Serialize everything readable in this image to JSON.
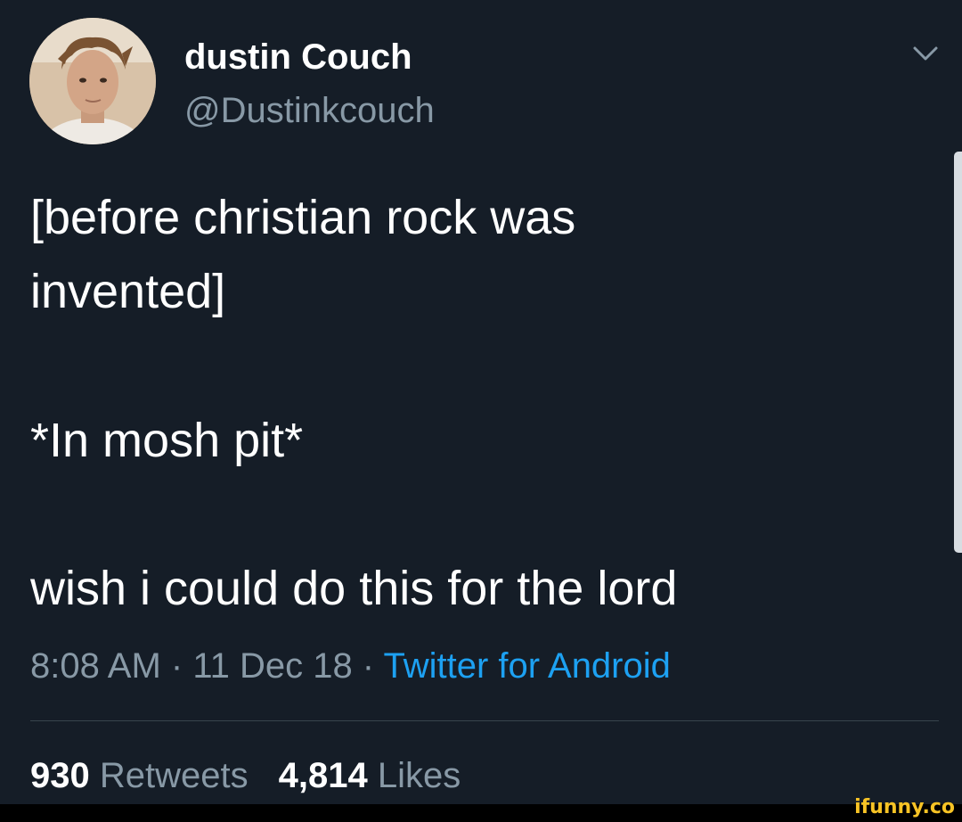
{
  "user": {
    "display_name": "dustin Couch",
    "handle": "@Dustinkcouch"
  },
  "tweet": {
    "lines": [
      "[before christian rock was",
      "invented]",
      "*In mosh pit*",
      "wish i could do this for the lord"
    ],
    "time": "8:08 AM",
    "date": "11 Dec 18",
    "separator": " · ",
    "source": "Twitter for Android"
  },
  "stats": {
    "retweets_count": "930",
    "retweets_label": "Retweets",
    "likes_count": "4,814",
    "likes_label": "Likes"
  },
  "watermark": "ifunny.co",
  "icons": {
    "chevron": "chevron-down-icon",
    "avatar": "avatar"
  },
  "colors": {
    "background": "#151d27",
    "primary_text": "#ffffff",
    "secondary_text": "#8899a6",
    "link": "#1da1f2",
    "divider": "#38444d",
    "watermark": "#f7c325"
  }
}
